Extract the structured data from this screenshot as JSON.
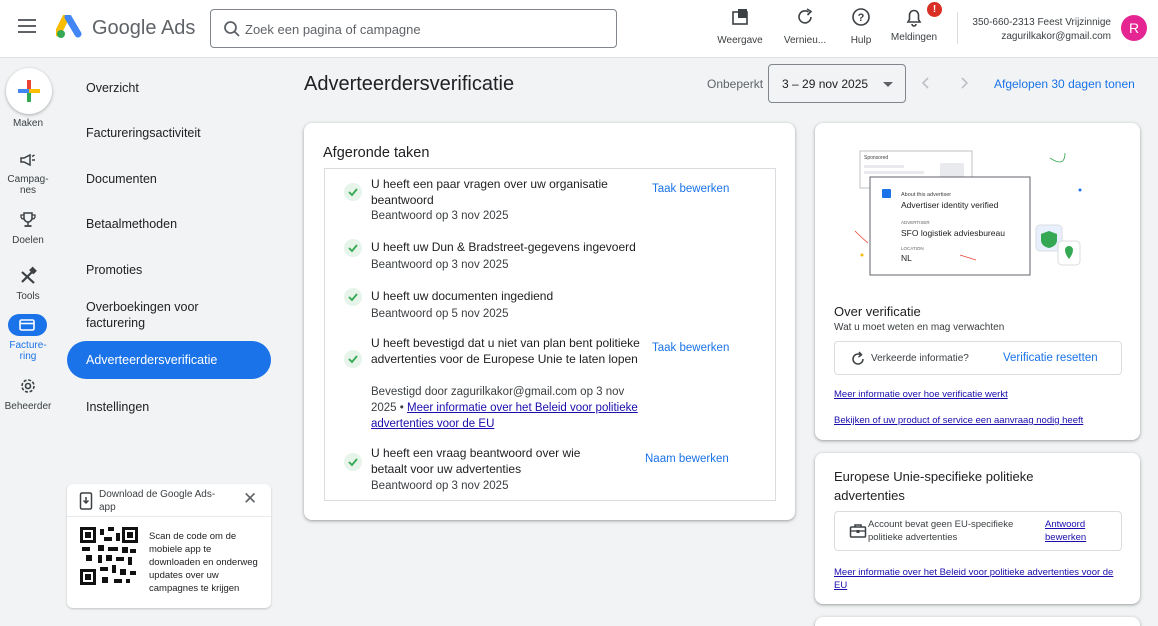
{
  "topbar": {
    "product_name": "Google Ads",
    "search_placeholder": "Zoek een pagina of campagne",
    "tools": {
      "appearance": "Weergave",
      "refresh": "Vernieu...",
      "help": "Hulp",
      "notifications": "Meldingen",
      "notification_count": "!"
    },
    "account": {
      "line1": "350-660-2313 Feest Vrijzinnige",
      "email": "zagurilkakor@gmail.com",
      "avatar_letter": "R",
      "avatar_color": "#e52592"
    }
  },
  "rail": {
    "make": "Maken",
    "campaigns": "Campag-\nnes",
    "goals": "Doelen",
    "tools": "Tools",
    "billing": "Facture-\nring",
    "admin": "Beheerder"
  },
  "nav": {
    "items": [
      "Overzicht",
      "Factureringsactiviteit",
      "Documenten",
      "Betaalmethoden",
      "Promoties",
      "Overboekingen voor facturering",
      "Adverteerdersverificatie",
      "Instellingen"
    ]
  },
  "qr_card": {
    "title": "Download de Google Ads-app",
    "text": "Scan de code om de mobiele app te downloaden en onderweg updates over uw campagnes te krijgen"
  },
  "header": {
    "title": "Adverteerdersverificatie",
    "range_label": "Onbeperkt",
    "date_range": "3 – 29 nov 2025",
    "show_link": "Afgelopen 30 dagen tonen"
  },
  "tasks": {
    "title": "Afgeronde taken",
    "items": [
      {
        "title": "U heeft een paar vragen over uw organisatie beantwoord",
        "sub": "Beantwoord op 3 nov 2025",
        "action": "Taak bewerken"
      },
      {
        "title": "U heeft uw Dun & Bradstreet-gegevens ingevoerd",
        "sub": "Beantwoord op 3 nov 2025",
        "action": ""
      },
      {
        "title": "U heeft uw documenten ingediend",
        "sub": "Beantwoord op 5 nov 2025",
        "action": ""
      },
      {
        "title": "U heeft bevestigd dat u niet van plan bent politieke advertenties voor de Europese Unie te laten lopen",
        "sub": "Bevestigd door zagurilkakor@gmail.com op 3 nov 2025 • ",
        "sub_link": "Meer informatie over het Beleid voor politieke advertenties voor de EU",
        "action": "Taak bewerken"
      },
      {
        "title": "U heeft een vraag beantwoord over wie betaalt voor uw advertenties",
        "sub": "Beantwoord op 3 nov 2025",
        "action": "Naam bewerken"
      }
    ]
  },
  "verification": {
    "illustration": {
      "sponsored": "Sponsored",
      "about": "About this advertiser",
      "verified": "Advertiser identity verified",
      "advertiser_label": "ADVERTISER",
      "advertiser_name": "SFO logistiek adviesbureau",
      "location_label": "LOCATION",
      "location": "NL"
    },
    "title": "Over verificatie",
    "subtitle": "Wat u moet weten en mag verwachten",
    "wrong_info": "Verkeerde informatie?",
    "reset_button": "Verificatie resetten",
    "link1": "Meer informatie over hoe verificatie werkt",
    "link2": "Bekijken of uw product of service een aanvraag nodig heeft"
  },
  "eu": {
    "title": "Europese Unie-specifieke politieke advertenties",
    "box_text": "Account bevat geen EU-specifieke politieke advertenties",
    "edit_link": "Antwoord bewerken",
    "link": "Meer informatie over het Beleid voor politieke advertenties voor de EU"
  }
}
